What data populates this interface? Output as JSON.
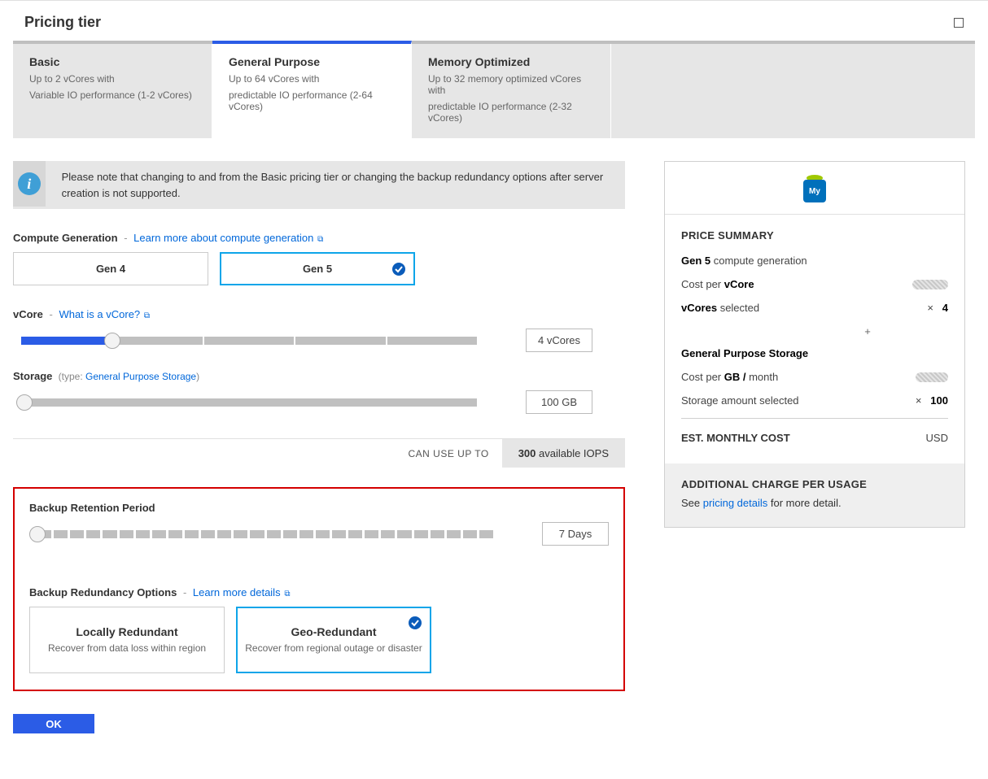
{
  "header": {
    "title": "Pricing tier"
  },
  "tabs": [
    {
      "title": "Basic",
      "line1": "Up to 2 vCores with",
      "line2": "Variable IO performance (1-2 vCores)"
    },
    {
      "title": "General Purpose",
      "line1": "Up to 64 vCores with",
      "line2": "predictable IO performance (2-64 vCores)"
    },
    {
      "title": "Memory Optimized",
      "line1": "Up to 32 memory optimized vCores with",
      "line2": "predictable IO performance (2-32 vCores)"
    }
  ],
  "info_banner": "Please note that changing to and from the Basic pricing tier or changing the backup redundancy options after server creation is not supported.",
  "compute_gen": {
    "label": "Compute Generation",
    "link": "Learn more about compute generation",
    "options": {
      "a": "Gen 4",
      "b": "Gen 5"
    }
  },
  "vcore": {
    "label": "vCore",
    "link": "What is a vCore?",
    "value": "4 vCores"
  },
  "storage": {
    "label": "Storage",
    "type_prefix": "(type:",
    "type_link": "General Purpose Storage",
    "type_suffix": ")",
    "value": "100 GB"
  },
  "iops": {
    "label": "CAN USE UP TO",
    "num": "300",
    "suffix": " available IOPS"
  },
  "retention": {
    "label": "Backup Retention Period",
    "value": "7 Days"
  },
  "redundancy": {
    "label": "Backup Redundancy Options",
    "link": "Learn more details",
    "options": {
      "local": {
        "title": "Locally Redundant",
        "sub": "Recover from data loss within region"
      },
      "geo": {
        "title": "Geo-Redundant",
        "sub": "Recover from regional outage or disaster"
      }
    }
  },
  "ok_label": "OK",
  "price_panel": {
    "heading": "PRICE SUMMARY",
    "gen_prefix": "Gen 5 ",
    "gen_suffix": "compute generation",
    "cost_vcore_pre": "Cost per ",
    "cost_vcore_bold": "vCore",
    "vcores_bold": "vCores",
    "vcores_suffix": " selected",
    "vcores_val": "4",
    "plus": "+",
    "storage_heading": "General Purpose Storage",
    "cost_gb_pre": "Cost per ",
    "cost_gb_bold": "GB / ",
    "cost_gb_post": "month",
    "storage_sel": "Storage amount selected",
    "storage_val": "100",
    "est_label": "EST. MONTHLY COST",
    "est_currency": "USD",
    "footer_heading": "ADDITIONAL CHARGE PER USAGE",
    "footer_pre": "See ",
    "footer_link": "pricing details",
    "footer_post": " for more detail."
  }
}
